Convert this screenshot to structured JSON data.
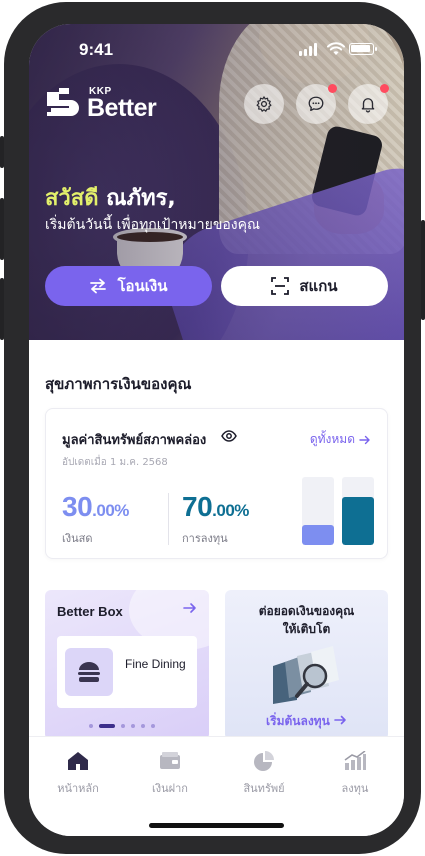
{
  "status_bar": {
    "time": "9:41"
  },
  "header": {
    "logo_small": "KKP",
    "logo_name": "Better",
    "settings_icon": "gear-icon",
    "chat_icon": "chat-bubble-icon",
    "bell_icon": "bell-icon"
  },
  "greeting": {
    "hello": "สวัสดี",
    "name": " ณภัทร,",
    "subtitle": "เริ่มต้นวันนี้ เพื่อทุกเป้าหมายของคุณ"
  },
  "actions": {
    "transfer_label": "โอนเงิน",
    "transfer_icon": "swap-arrows-icon",
    "scan_label": "สแกน",
    "scan_icon": "scan-frame-icon"
  },
  "financial_health": {
    "section_title": "สุขภาพการเงินของคุณ",
    "card_title": "มูลค่าสินทรัพย์สภาพคล่อง",
    "see_all": "ดูทั้งหมด",
    "updated": "อัปเดตเมื่อ 1 ม.ค. 2568",
    "cash": {
      "whole": "30",
      "decimal": ".00%",
      "label": "เงินสด",
      "fraction": 0.3,
      "color": "#7d8ef0"
    },
    "invest": {
      "whole": "70",
      "decimal": ".00%",
      "label": "การลงทุน",
      "fraction": 0.7,
      "color": "#0e6f93"
    }
  },
  "better_box": {
    "title": "Better Box",
    "item_label": "Fine Dining",
    "item_icon": "burger-icon",
    "carousel_pages": 6,
    "carousel_active": 1
  },
  "grow_card": {
    "title_line1": "ต่อยอดเงินของคุณ",
    "title_line2": "ให้เติบโต",
    "cta": "เริ่มต้นลงทุน"
  },
  "tabs": [
    {
      "label": "หน้าหลัก",
      "icon": "home-icon",
      "active": true
    },
    {
      "label": "เงินฝาก",
      "icon": "wallet-icon",
      "active": false
    },
    {
      "label": "สินทรัพย์",
      "icon": "pie-chart-icon",
      "active": false
    },
    {
      "label": "ลงทุน",
      "icon": "bar-chart-icon",
      "active": false
    }
  ]
}
